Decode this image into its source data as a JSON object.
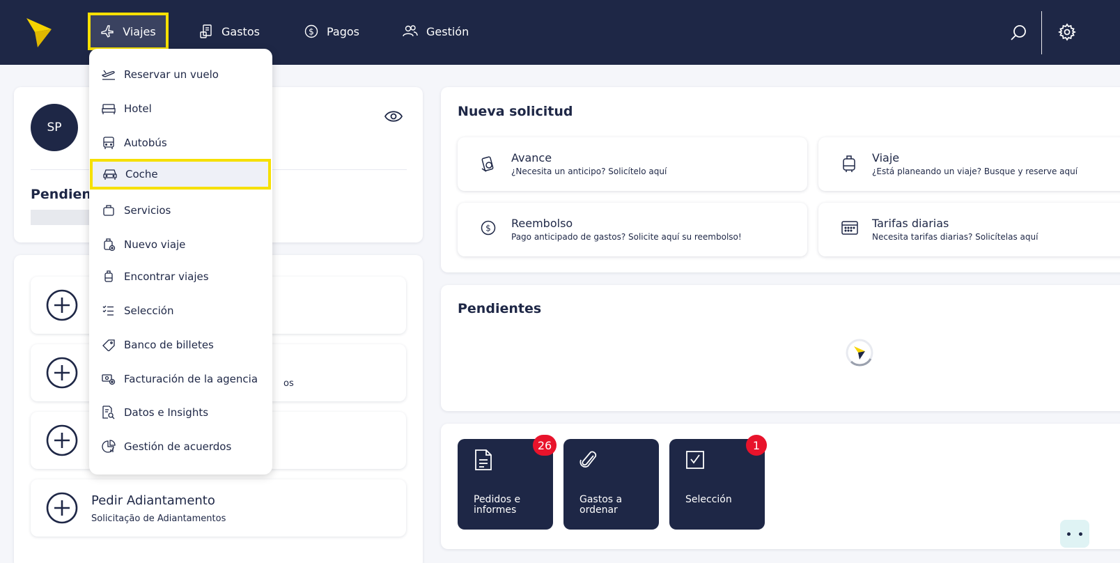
{
  "nav": {
    "viajes": "Viajes",
    "gastos": "Gastos",
    "pagos": "Pagos",
    "gestion": "Gestión"
  },
  "profile": {
    "initials": "SP",
    "pending_label": "Pendient"
  },
  "actions": [
    {
      "title": "",
      "subtitle": ""
    },
    {
      "title": "",
      "subtitle": "os"
    },
    {
      "title": "",
      "subtitle": ""
    },
    {
      "title": "Pedir Adiantamento",
      "subtitle": "Solicitação de Adiantamentos"
    }
  ],
  "nueva_solicitud": {
    "title": "Nueva solicitud",
    "items": [
      {
        "title": "Avance",
        "subtitle": "¿Necesita un anticipo? Solicítelo aquí",
        "icon": "advance-icon"
      },
      {
        "title": "Viaje",
        "subtitle": "¿Está planeando un viaje? Busque y reserve aquí",
        "icon": "luggage-icon"
      },
      {
        "title": "Reembolso",
        "subtitle": "Pago anticipado de gastos? Solicite aquí su reembolso!",
        "icon": "dollar-icon"
      },
      {
        "title": "Tarifas diarias",
        "subtitle": "Necesita tarifas diarias? Solicítelas aquí",
        "icon": "calendar-icon"
      }
    ]
  },
  "pendientes": {
    "title": "Pendientes"
  },
  "tiles": [
    {
      "label": "Pedidos e informes",
      "badge": "26",
      "icon": "document-icon"
    },
    {
      "label": "Gastos a ordenar",
      "badge": "",
      "icon": "paperclip-icon"
    },
    {
      "label": "Selección",
      "badge": "1",
      "icon": "checkbox-icon"
    }
  ],
  "dropdown": {
    "items": [
      "Reservar un vuelo",
      "Hotel",
      "Autobús",
      "Coche",
      "Servicios",
      "Nuevo viaje",
      "Encontrar viajes",
      "Selección",
      "Banco de billetes",
      "Facturación de la agencia",
      "Datos e Insights",
      "Gestión de acuerdos"
    ]
  },
  "colors": {
    "navy": "#1e2746",
    "highlight": "#f6e000",
    "badge": "#e8132b",
    "logo": "#f6d400"
  }
}
